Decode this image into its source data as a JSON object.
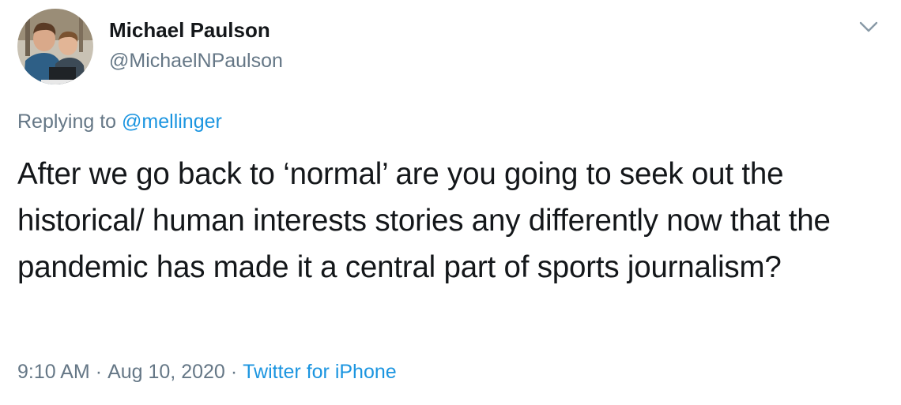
{
  "author": {
    "display_name": "Michael Paulson",
    "handle": "@MichaelNPaulson",
    "avatar": "avatar-photo"
  },
  "menu_icon": "chevron-down-icon",
  "reply": {
    "prefix": "Replying to ",
    "mention": "@mellinger"
  },
  "tweet": {
    "text": "After we go back to ‘normal’ are you going to seek out the historical/ human interests stories any differently now that the pandemic has made it a central part of sports journalism?"
  },
  "meta": {
    "time": "9:10 AM",
    "separator": "·",
    "date": "Aug 10, 2020",
    "source": "Twitter for iPhone"
  },
  "colors": {
    "text": "#14171a",
    "secondary": "#657786",
    "link": "#1b95e0"
  }
}
